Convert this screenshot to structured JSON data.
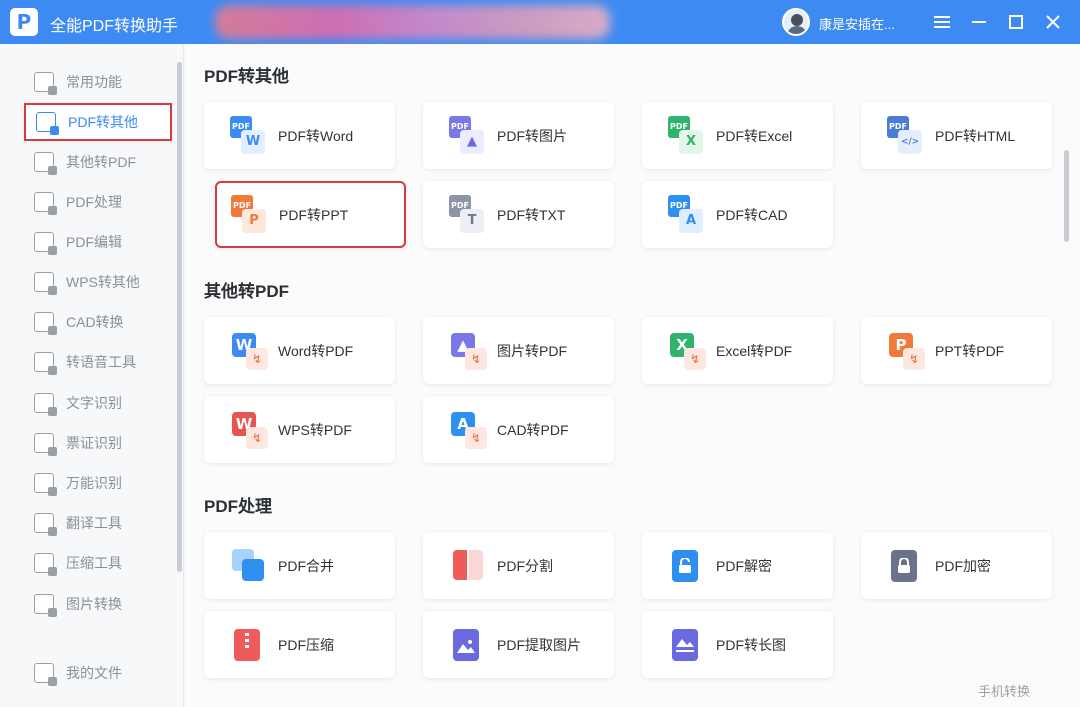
{
  "app": {
    "title": "全能PDF转换助手",
    "logo_letter": "P",
    "user_name": "康是安插在..."
  },
  "sidebar": {
    "items": [
      {
        "label": "常用功能"
      },
      {
        "label": "PDF转其他"
      },
      {
        "label": "其他转PDF"
      },
      {
        "label": "PDF处理"
      },
      {
        "label": "PDF编辑"
      },
      {
        "label": "WPS转其他"
      },
      {
        "label": "CAD转换"
      },
      {
        "label": "转语音工具"
      },
      {
        "label": "文字识别"
      },
      {
        "label": "票证识别"
      },
      {
        "label": "万能识别"
      },
      {
        "label": "翻译工具"
      },
      {
        "label": "压缩工具"
      },
      {
        "label": "图片转换"
      }
    ],
    "footer": {
      "label": "我的文件"
    },
    "active_index": 1
  },
  "sections": {
    "pdf_to_other": {
      "title": "PDF转其他",
      "cards": [
        {
          "label": "PDF转Word",
          "badge": "PDF",
          "sub": "W"
        },
        {
          "label": "PDF转图片",
          "badge": "PDF",
          "sub": "▲"
        },
        {
          "label": "PDF转Excel",
          "badge": "PDF",
          "sub": "X"
        },
        {
          "label": "PDF转HTML",
          "badge": "PDF",
          "sub": "</>"
        },
        {
          "label": "PDF转PPT",
          "badge": "PDF",
          "sub": "P"
        },
        {
          "label": "PDF转TXT",
          "badge": "PDF",
          "sub": "T"
        },
        {
          "label": "PDF转CAD",
          "badge": "PDF",
          "sub": "A"
        }
      ]
    },
    "other_to_pdf": {
      "title": "其他转PDF",
      "cards": [
        {
          "label": "Word转PDF",
          "badge": "W"
        },
        {
          "label": "图片转PDF",
          "badge": "▲"
        },
        {
          "label": "Excel转PDF",
          "badge": "X"
        },
        {
          "label": "PPT转PDF",
          "badge": "P"
        },
        {
          "label": "WPS转PDF",
          "badge": "W"
        },
        {
          "label": "CAD转PDF",
          "badge": "A"
        }
      ]
    },
    "pdf_processing": {
      "title": "PDF处理",
      "cards": [
        {
          "label": "PDF合并"
        },
        {
          "label": "PDF分割"
        },
        {
          "label": "PDF解密"
        },
        {
          "label": "PDF加密"
        },
        {
          "label": "PDF压缩"
        },
        {
          "label": "PDF提取图片"
        },
        {
          "label": "PDF转长图"
        }
      ]
    }
  },
  "footer_link": "手机转换",
  "colors": {
    "accent": "#3d8bf2",
    "highlight": "#d73c3c"
  }
}
